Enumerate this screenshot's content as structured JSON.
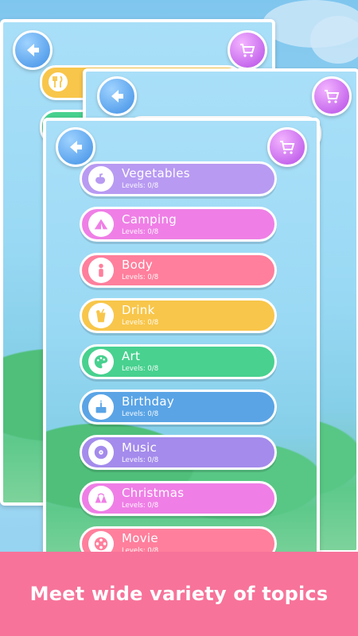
{
  "colors": {
    "purple": "#b89af2",
    "magenta": "#ef7fe6",
    "pink": "#ff7f9c",
    "yellow": "#f8c64a",
    "green": "#48d18f",
    "blue": "#5aa4e6",
    "violet": "#a48bec",
    "banner": "#f7739a"
  },
  "topics": [
    {
      "name": "Vegetables",
      "levels": "Levels: 0/8",
      "icon": "vegetables-icon"
    },
    {
      "name": "Camping",
      "levels": "Levels: 0/8",
      "icon": "tent-icon"
    },
    {
      "name": "Body",
      "levels": "Levels: 0/8",
      "icon": "person-icon"
    },
    {
      "name": "Drink",
      "levels": "Levels: 0/8",
      "icon": "drink-icon"
    },
    {
      "name": "Art",
      "levels": "Levels: 0/8",
      "icon": "palette-icon"
    },
    {
      "name": "Birthday",
      "levels": "Levels: 0/8",
      "icon": "cake-icon"
    },
    {
      "name": "Music",
      "levels": "Levels: 0/8",
      "icon": "disc-icon"
    },
    {
      "name": "Christmas",
      "levels": "Levels: 0/8",
      "icon": "bells-icon"
    },
    {
      "name": "Movie",
      "levels": "Levels: 0/8",
      "icon": "film-reel-icon"
    }
  ],
  "banner": {
    "text": "Meet wide variety of topics"
  }
}
